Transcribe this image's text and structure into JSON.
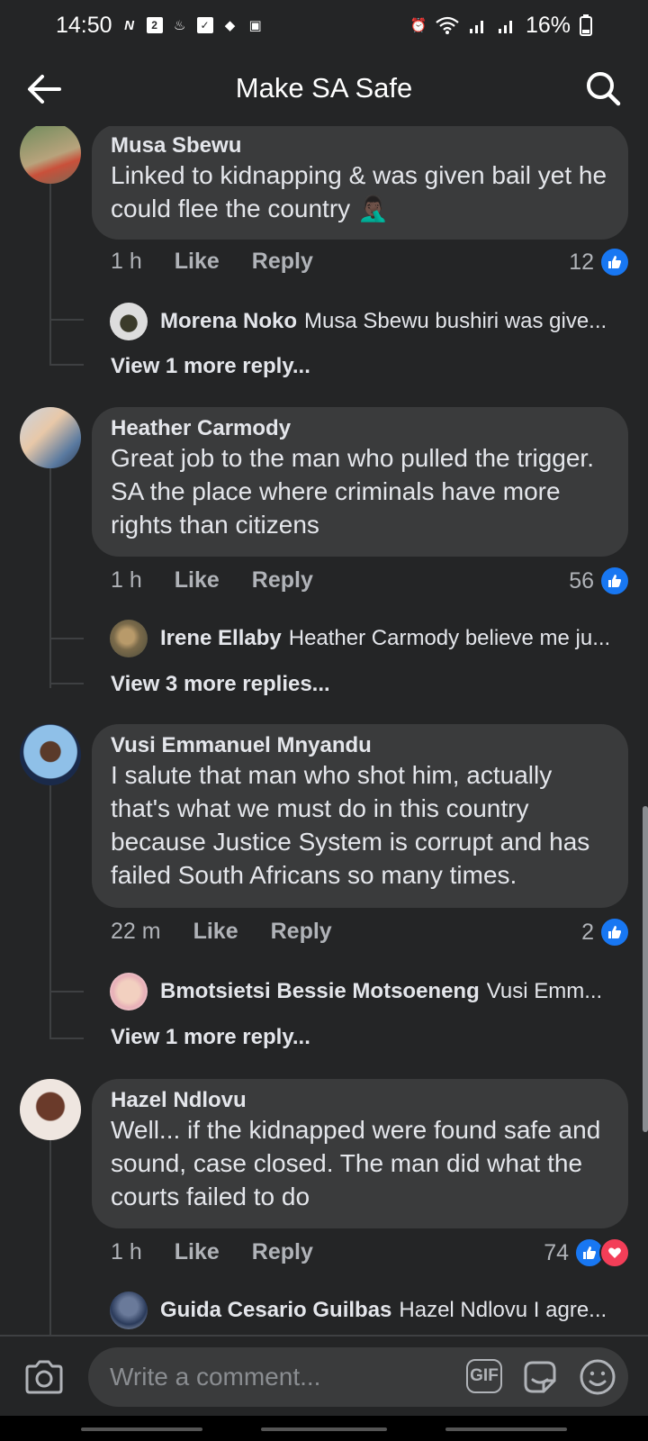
{
  "status_bar": {
    "time": "14:50",
    "battery": "16%",
    "notif_box_label": "2"
  },
  "header": {
    "title": "Make SA Safe"
  },
  "comments": [
    {
      "author": "Musa Sbewu",
      "text": "Linked to kidnapping & was given bail yet he could flee the country 🤦🏿‍♂️",
      "time": "1 h",
      "like": "Like",
      "reply": "Reply",
      "reaction_count": "12",
      "reactions": [
        "like"
      ],
      "reply_preview": {
        "author": "Morena Noko",
        "text": "Musa Sbewu bushiri was give..."
      },
      "more_replies": "View 1 more reply..."
    },
    {
      "author": "Heather Carmody",
      "text": "Great job to the man who pulled the trigger. SA the place where criminals have more rights than citizens",
      "time": "1 h",
      "like": "Like",
      "reply": "Reply",
      "reaction_count": "56",
      "reactions": [
        "like"
      ],
      "reply_preview": {
        "author": "Irene Ellaby",
        "text": "Heather Carmody believe me ju..."
      },
      "more_replies": "View 3 more replies..."
    },
    {
      "author": "Vusi Emmanuel Mnyandu",
      "text": "I salute that man who shot him, actually that's what we  must do in this country because Justice System is corrupt and has failed South Africans so many times.",
      "time": "22 m",
      "like": "Like",
      "reply": "Reply",
      "reaction_count": "2",
      "reactions": [
        "like"
      ],
      "reply_preview": {
        "author": "Bmotsietsi Bessie Motsoeneng",
        "text": "Vusi Emm..."
      },
      "more_replies": "View 1 more reply..."
    },
    {
      "author": "Hazel Ndlovu",
      "text": "Well... if the kidnapped were found safe and sound, case closed. The man did what the courts failed to do",
      "time": "1 h",
      "like": "Like",
      "reply": "Reply",
      "reaction_count": "74",
      "reactions": [
        "like",
        "love"
      ],
      "reply_preview": {
        "author": "Guida Cesario Guilbas",
        "text": "Hazel Ndlovu I agre..."
      }
    }
  ],
  "composer": {
    "placeholder": "Write a comment...",
    "gif_label": "GIF"
  },
  "colors": {
    "background": "#242526",
    "bubble": "#3a3b3c",
    "like_blue": "#1877f2",
    "love_red": "#f33e58",
    "secondary_text": "#b0b3b8"
  },
  "icons": [
    "back-arrow-icon",
    "search-icon",
    "camera-icon",
    "gif-icon",
    "sticker-icon",
    "emoji-icon",
    "like-reaction-icon",
    "love-reaction-icon"
  ]
}
